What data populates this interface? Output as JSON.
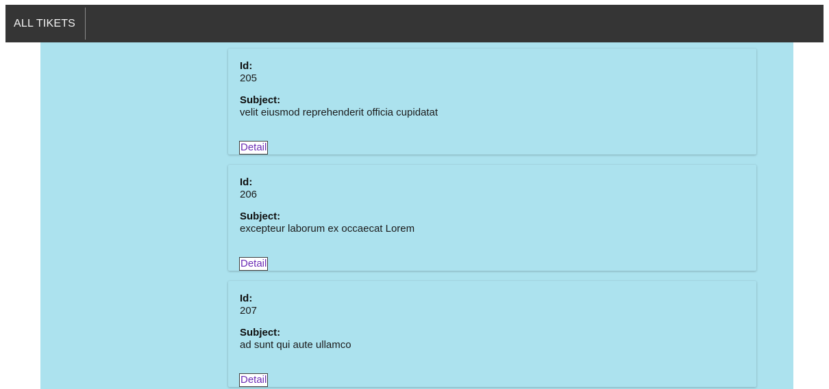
{
  "nav": {
    "all_tickets_label": "ALL TIKETS"
  },
  "tickets": [
    {
      "id_label": "Id:",
      "id": "205",
      "subject_label": "Subject:",
      "subject": "velit eiusmod reprehenderit officia cupidatat",
      "detail_label": "Detail"
    },
    {
      "id_label": "Id:",
      "id": "206",
      "subject_label": "Subject:",
      "subject": "excepteur laborum ex occaecat Lorem",
      "detail_label": "Detail"
    },
    {
      "id_label": "Id:",
      "id": "207",
      "subject_label": "Subject:",
      "subject": "ad sunt qui aute ullamco",
      "detail_label": "Detail"
    }
  ],
  "colors": {
    "topbar_bg": "#353535",
    "content_bg": "#ace2ee",
    "link": "#6a2bb5"
  }
}
